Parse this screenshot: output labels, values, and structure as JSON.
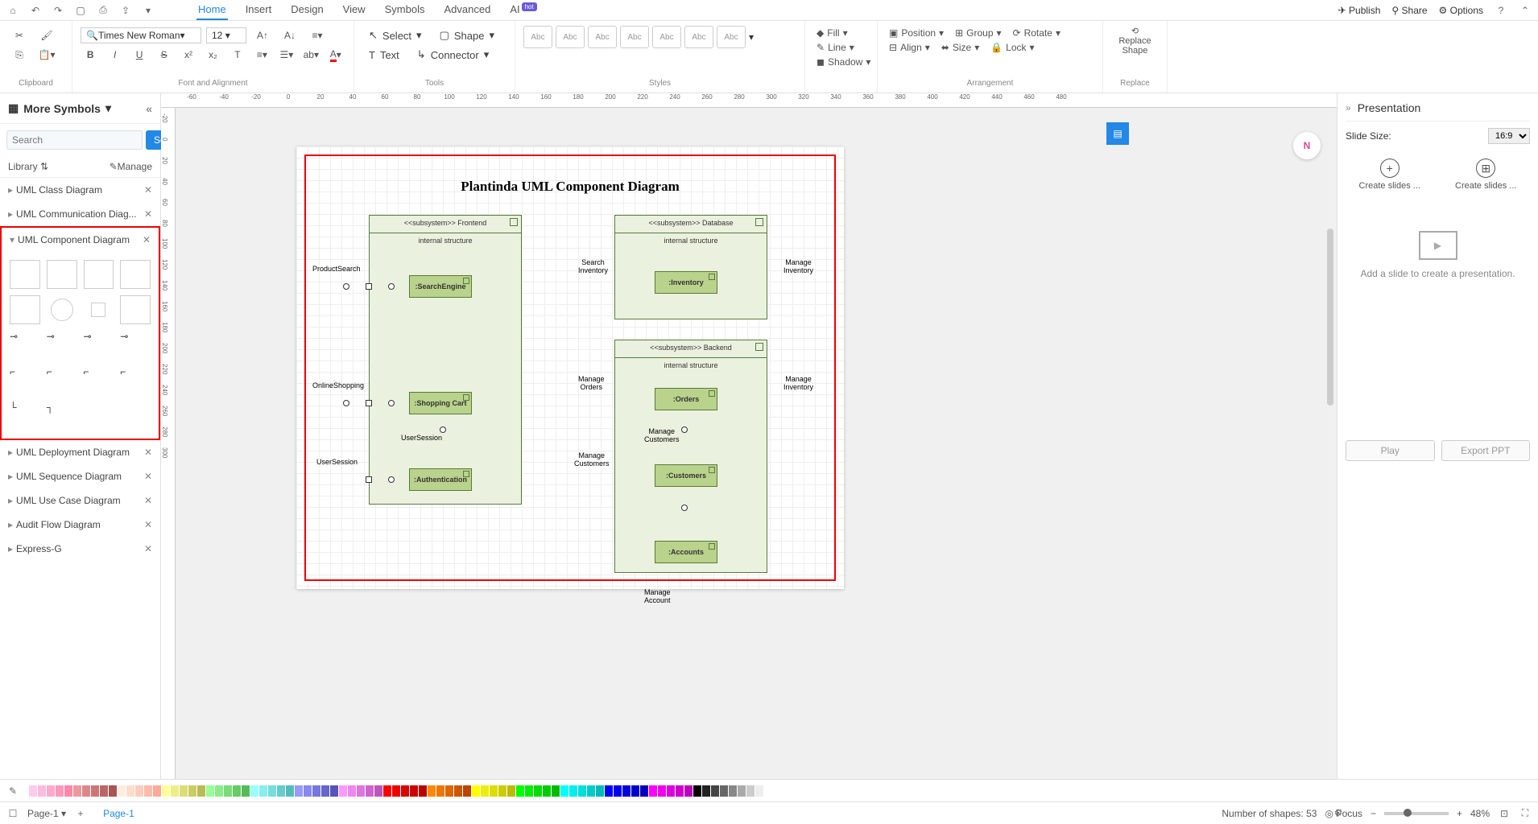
{
  "titlebar": {
    "tabs": [
      "Home",
      "Insert",
      "Design",
      "View",
      "Symbols",
      "Advanced",
      "AI"
    ],
    "active_tab": 0,
    "hot_label": "hot",
    "right": {
      "publish": "Publish",
      "share": "Share",
      "options": "Options"
    }
  },
  "ribbon": {
    "clipboard": {
      "label": "Clipboard"
    },
    "font": {
      "label": "Font and Alignment",
      "family": "Times New Roman",
      "size": "12"
    },
    "tools": {
      "label": "Tools",
      "select": "Select",
      "shape": "Shape",
      "text": "Text",
      "connector": "Connector"
    },
    "styles": {
      "label": "Styles",
      "sample": "Abc"
    },
    "effects": {
      "fill": "Fill",
      "line": "Line",
      "shadow": "Shadow"
    },
    "arrangement": {
      "label": "Arrangement",
      "position": "Position",
      "group": "Group",
      "rotate": "Rotate",
      "align": "Align",
      "size": "Size",
      "lock": "Lock"
    },
    "replace": {
      "label": "Replace",
      "shape": "Replace Shape"
    }
  },
  "sidebar": {
    "more_symbols": "More Symbols",
    "search_placeholder": "Search",
    "search_btn": "Search",
    "library": "Library",
    "manage": "Manage",
    "items": [
      "UML Class Diagram",
      "UML Communication Diag...",
      "UML Component Diagram",
      "UML Deployment Diagram",
      "UML Sequence Diagram",
      "UML Use Case Diagram",
      "Audit Flow Diagram",
      "Express-G"
    ]
  },
  "canvas": {
    "title": "Plantinda UML Component Diagram",
    "subsystems": {
      "frontend": {
        "head": "<<subsystem>> Frontend",
        "internal": "internal structure"
      },
      "database": {
        "head": "<<subsystem>> Database",
        "internal": "internal structure"
      },
      "backend": {
        "head": "<<subsystem>> Backend",
        "internal": "internal structure"
      }
    },
    "components": {
      "search": ":SearchEngine",
      "cart": ":Shopping Cart",
      "auth": ":Authentication",
      "inventory": ":Inventory",
      "orders": ":Orders",
      "customers": ":Customers",
      "accounts": ":Accounts"
    },
    "labels": {
      "product_search": "ProductSearch",
      "online_shopping": "OnlineShopping",
      "user_session1": "UserSession",
      "user_session2": "UserSession",
      "search_inv": "Search\nInventory",
      "manage_orders": "Manage\nOrders",
      "manage_cust": "Manage\nCustomers",
      "manage_inv1": "Manage\nInventory",
      "manage_inv2": "Manage\nInventory",
      "manage_cust2": "Manage\nCustomers",
      "manage_acct": "Manage\nAccount"
    },
    "ruler_h": [
      "-60",
      "-40",
      "-20",
      "0",
      "20",
      "40",
      "60",
      "80",
      "100",
      "120",
      "140",
      "160",
      "180",
      "200",
      "220",
      "240",
      "260",
      "280",
      "300",
      "320",
      "340",
      "360",
      "380",
      "400",
      "420",
      "440",
      "460",
      "480"
    ],
    "ruler_v": [
      "-20",
      "0",
      "20",
      "40",
      "60",
      "80",
      "100",
      "120",
      "140",
      "160",
      "180",
      "200",
      "220",
      "240",
      "260",
      "280",
      "300"
    ]
  },
  "presentation": {
    "title": "Presentation",
    "slide_size_label": "Slide Size:",
    "slide_size": "16:9",
    "create1": "Create slides ...",
    "create2": "Create slides ...",
    "empty": "Add a slide to create a presentation.",
    "play": "Play",
    "export": "Export PPT"
  },
  "status": {
    "page_tab": "Page-1",
    "page_tab2": "Page-1",
    "shapes": "Number of shapes: 53",
    "focus": "Focus",
    "zoom": "48%"
  }
}
